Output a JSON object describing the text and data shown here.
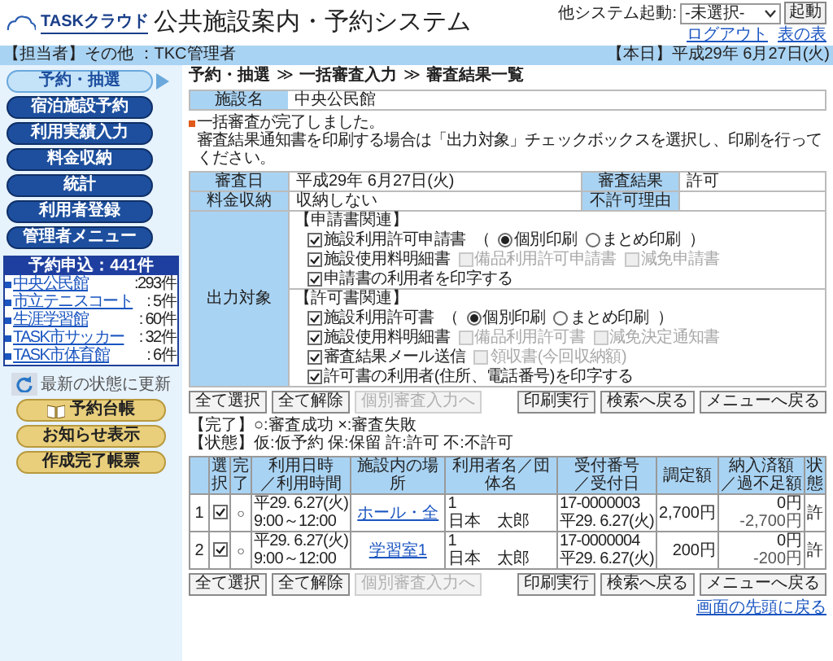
{
  "header": {
    "logo_text": "TASKクラウド",
    "title": "公共施設案内・予約システム",
    "launch_label": "他システム起動:",
    "launch_select": "-未選択-",
    "launch_button": "起動",
    "links": [
      "ログアウト",
      "表の表"
    ]
  },
  "user_bar": {
    "user": "【担当者】その他 ：TKC管理者",
    "date": "【本日】平成29年 6月27日(火)"
  },
  "sidebar": {
    "menu": [
      {
        "label": "予約・抽選",
        "selected": true
      },
      {
        "label": "宿泊施設予約",
        "selected": false
      },
      {
        "label": "利用実績入力",
        "selected": false
      },
      {
        "label": "料金収納",
        "selected": false
      },
      {
        "label": "統計",
        "selected": false
      },
      {
        "label": "利用者登録",
        "selected": false
      },
      {
        "label": "管理者メニュー",
        "selected": false
      }
    ],
    "reservations": {
      "title": "予約申込：441件",
      "items": [
        {
          "name": "中央公民館",
          "count": ":293件"
        },
        {
          "name": "市立テニスコート",
          "count": ": 5件"
        },
        {
          "name": "生涯学習館",
          "count": ": 60件"
        },
        {
          "name": "TASK市サッカー",
          "count": ": 32件"
        },
        {
          "name": "TASK市体育館",
          "count": ": 6件"
        }
      ]
    },
    "refresh": "最新の状態に更新",
    "buttons": [
      {
        "label": "予約台帳",
        "kind": "book"
      },
      {
        "label": "お知らせ表示",
        "kind": "plain"
      },
      {
        "label": "作成完了帳票",
        "kind": "plain"
      }
    ]
  },
  "breadcrumb": {
    "separator": "≫",
    "items": [
      "予約・抽選",
      "一括審査入力",
      "審査結果一覧"
    ]
  },
  "facility": {
    "label": "施設名",
    "value": "中央公民館"
  },
  "message": [
    "一括審査が完了しました。",
    "審査結果通知書を印刷する場合は「出力対象」チェックボックスを選択し、印刷を行ってください。"
  ],
  "info_rows": [
    {
      "label": "審査日",
      "value": "平成29年 6月27日(火)",
      "label2": "審査結果",
      "value2": "許可"
    },
    {
      "label": "料金収納",
      "value": "収納しない",
      "label2": "不許可理由"
    }
  ],
  "output": {
    "label": "出力対象",
    "groups": [
      {
        "title": "【申請書関連】",
        "lines": [
          [
            {
              "kind": "checkbox",
              "label": "施設利用許可申請書",
              "checked": true,
              "disabled": false
            },
            {
              "kind": "text",
              "label": "（"
            },
            {
              "kind": "radio",
              "label": "個別印刷",
              "selected": true
            },
            {
              "kind": "radio",
              "label": "まとめ印刷",
              "selected": false
            },
            {
              "kind": "text",
              "label": "）"
            }
          ],
          [
            {
              "kind": "checkbox",
              "label": "施設使用料明細書",
              "checked": true,
              "disabled": false
            },
            {
              "kind": "checkbox",
              "label": "備品利用許可申請書",
              "checked": false,
              "disabled": true
            },
            {
              "kind": "checkbox",
              "label": "減免申請書",
              "checked": false,
              "disabled": true
            }
          ],
          [
            {
              "kind": "checkbox",
              "label": "申請書の利用者を印字する",
              "checked": true,
              "disabled": false
            }
          ]
        ]
      },
      {
        "title": "【許可書関連】",
        "lines": [
          [
            {
              "kind": "checkbox",
              "label": "施設利用許可書",
              "checked": true,
              "disabled": false
            },
            {
              "kind": "text",
              "label": "（"
            },
            {
              "kind": "radio",
              "label": "個別印刷",
              "selected": true
            },
            {
              "kind": "radio",
              "label": "まとめ印刷",
              "selected": false
            },
            {
              "kind": "text",
              "label": "）"
            }
          ],
          [
            {
              "kind": "checkbox",
              "label": "施設使用料明細書",
              "checked": true,
              "disabled": false
            },
            {
              "kind": "checkbox",
              "label": "備品利用許可書",
              "checked": false,
              "disabled": true
            },
            {
              "kind": "checkbox",
              "label": "減免決定通知書",
              "checked": false,
              "disabled": true
            }
          ],
          [
            {
              "kind": "checkbox",
              "label": "審査結果メール送信",
              "checked": true,
              "disabled": false
            },
            {
              "kind": "checkbox",
              "label": "領収書(今回収納額)",
              "checked": false,
              "disabled": true
            }
          ],
          [
            {
              "kind": "checkbox",
              "label": "許可書の利用者(住所、電話番号)を印字する",
              "checked": true,
              "disabled": false
            }
          ]
        ]
      }
    ]
  },
  "actions_top": {
    "left": [
      {
        "label": "全て選択",
        "disabled": false
      },
      {
        "label": "全て解除",
        "disabled": false
      },
      {
        "label": "個別審査入力へ",
        "disabled": true
      }
    ],
    "right": [
      {
        "label": "印刷実行",
        "disabled": false
      },
      {
        "label": "検索へ戻る",
        "disabled": false
      },
      {
        "label": "メニューへ戻る",
        "disabled": false
      }
    ]
  },
  "legend": [
    "【完了】○:審査成功 ×:審査失敗",
    "【状態】仮:仮予約 保:保留 許:許可 不:不許可"
  ],
  "table": {
    "columns": [
      [
        "選択"
      ],
      [
        "完了"
      ],
      [
        "利用日時",
        "／利用時間"
      ],
      [
        "施設内の場所"
      ],
      [
        "利用者名／団体名"
      ],
      [
        "受付番号",
        "／受付日"
      ],
      [
        "調定額"
      ],
      [
        "納入済額",
        "／過不足額"
      ],
      [
        "状態"
      ]
    ],
    "rows": [
      {
        "no": "1",
        "checked": true,
        "done": "○",
        "date": "平29. 6.27(火)",
        "time": "9:00～12:00",
        "place": "ホール・全",
        "user_no": "1",
        "user": "日本　太郎",
        "receipt": "17-0000003",
        "receipt_date": "平29. 6.27(火)",
        "amount": "2,700円",
        "paid": "0円",
        "diff": "-2,700円",
        "status": "許"
      },
      {
        "no": "2",
        "checked": true,
        "done": "○",
        "date": "平29. 6.27(火)",
        "time": "9:00～12:00",
        "place": "学習室1",
        "user_no": "1",
        "user": "日本　太郎",
        "receipt": "17-0000004",
        "receipt_date": "平29. 6.27(火)",
        "amount": "200円",
        "paid": "0円",
        "diff": "-200円",
        "status": "許"
      }
    ]
  },
  "actions_bottom": {
    "left": [
      {
        "label": "全て選択",
        "disabled": false
      },
      {
        "label": "全て解除",
        "disabled": false
      },
      {
        "label": "個別審査入力へ",
        "disabled": true
      }
    ],
    "right": [
      {
        "label": "印刷実行",
        "disabled": false
      },
      {
        "label": "検索へ戻る",
        "disabled": false
      },
      {
        "label": "メニューへ戻る",
        "disabled": false
      }
    ]
  },
  "top_link": "画面の先頭に戻る"
}
